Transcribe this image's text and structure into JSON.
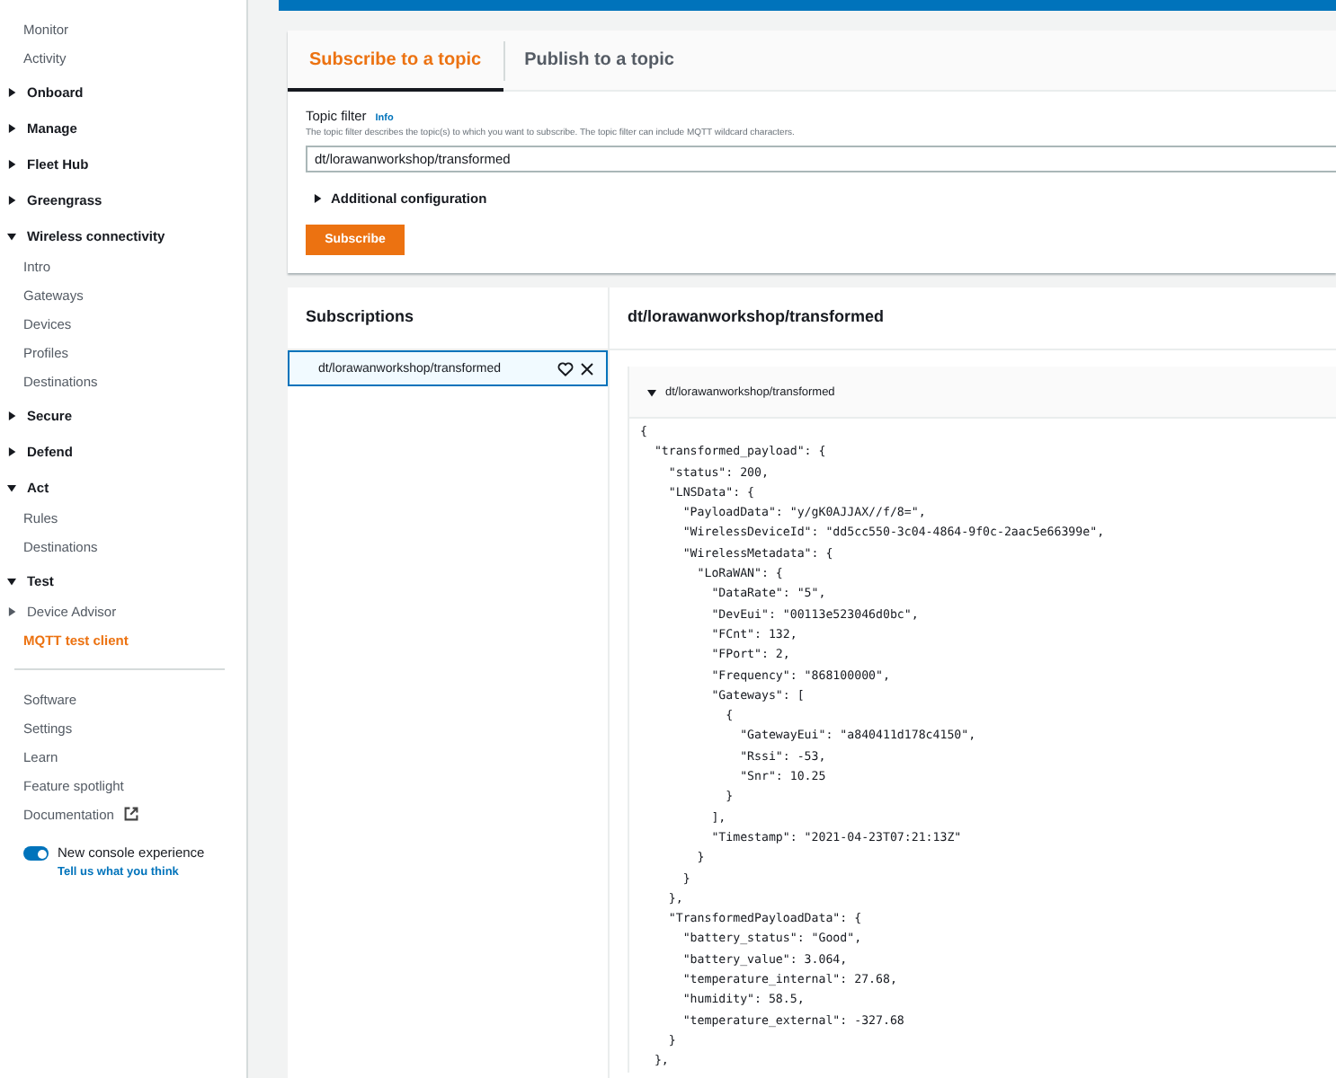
{
  "sidebar": {
    "items": [
      {
        "kind": "link",
        "label": "Monitor",
        "selected": false
      },
      {
        "kind": "link",
        "label": "Activity",
        "selected": false
      },
      {
        "kind": "section",
        "label": "Onboard",
        "expanded": false
      },
      {
        "kind": "section",
        "label": "Manage",
        "expanded": false
      },
      {
        "kind": "section",
        "label": "Fleet Hub",
        "expanded": false
      },
      {
        "kind": "section",
        "label": "Greengrass",
        "expanded": false
      },
      {
        "kind": "section",
        "label": "Wireless connectivity",
        "expanded": true,
        "children": [
          {
            "kind": "link",
            "label": "Intro",
            "selected": false
          },
          {
            "kind": "link",
            "label": "Gateways",
            "selected": false
          },
          {
            "kind": "link",
            "label": "Devices",
            "selected": false
          },
          {
            "kind": "link",
            "label": "Profiles",
            "selected": false
          },
          {
            "kind": "link",
            "label": "Destinations",
            "selected": false
          }
        ]
      },
      {
        "kind": "section",
        "label": "Secure",
        "expanded": false
      },
      {
        "kind": "section",
        "label": "Defend",
        "expanded": false
      },
      {
        "kind": "section",
        "label": "Act",
        "expanded": true,
        "children": [
          {
            "kind": "link",
            "label": "Rules",
            "selected": false
          },
          {
            "kind": "link",
            "label": "Destinations",
            "selected": false
          }
        ]
      },
      {
        "kind": "section",
        "label": "Test",
        "expanded": true,
        "children": [
          {
            "kind": "section",
            "label": "Device Advisor",
            "expanded": false
          },
          {
            "kind": "link",
            "label": "MQTT test client",
            "selected": true
          }
        ]
      }
    ],
    "footer_links": [
      {
        "label": "Software",
        "external": false
      },
      {
        "label": "Settings",
        "external": false
      },
      {
        "label": "Learn",
        "external": false
      },
      {
        "label": "Feature spotlight",
        "external": false
      },
      {
        "label": "Documentation",
        "external": true
      }
    ],
    "console_toggle": {
      "label": "New console experience",
      "on": true,
      "link": "Tell us what you think"
    }
  },
  "tabs": [
    {
      "label": "Subscribe to a topic",
      "selected": true
    },
    {
      "label": "Publish to a topic",
      "selected": false
    }
  ],
  "topic_filter": {
    "label": "Topic filter",
    "info": "Info",
    "description": "The topic filter describes the topic(s) to which you want to subscribe. The topic filter can include MQTT wildcard characters.",
    "value": "dt/lorawanworkshop/transformed"
  },
  "additional_configuration": {
    "label": "Additional configuration",
    "expanded": false
  },
  "subscribe_button": "Subscribe",
  "subscriptions": {
    "title": "Subscriptions",
    "items": [
      {
        "topic": "dt/lorawanworkshop/transformed",
        "selected": true
      }
    ]
  },
  "message_panel": {
    "title": "dt/lorawanworkshop/transformed",
    "message": {
      "topic": "dt/lorawanworkshop/transformed",
      "expanded": true,
      "body": "{\n  \"transformed_payload\": {\n    \"status\": 200,\n    \"LNSData\": {\n      \"PayloadData\": \"y/gK0AJJAX//f/8=\",\n      \"WirelessDeviceId\": \"dd5cc550-3c04-4864-9f0c-2aac5e66399e\",\n      \"WirelessMetadata\": {\n        \"LoRaWAN\": {\n          \"DataRate\": \"5\",\n          \"DevEui\": \"00113e523046d0bc\",\n          \"FCnt\": 132,\n          \"FPort\": 2,\n          \"Frequency\": \"868100000\",\n          \"Gateways\": [\n            {\n              \"GatewayEui\": \"a840411d178c4150\",\n              \"Rssi\": -53,\n              \"Snr\": 10.25\n            }\n          ],\n          \"Timestamp\": \"2021-04-23T07:21:13Z\"\n        }\n      }\n    },\n    \"TransformedPayloadData\": {\n      \"battery_status\": \"Good\",\n      \"battery_value\": 3.064,\n      \"temperature_internal\": 27.68,\n      \"humidity\": 58.5,\n      \"temperature_external\": -327.68\n    }\n  },"
    }
  }
}
